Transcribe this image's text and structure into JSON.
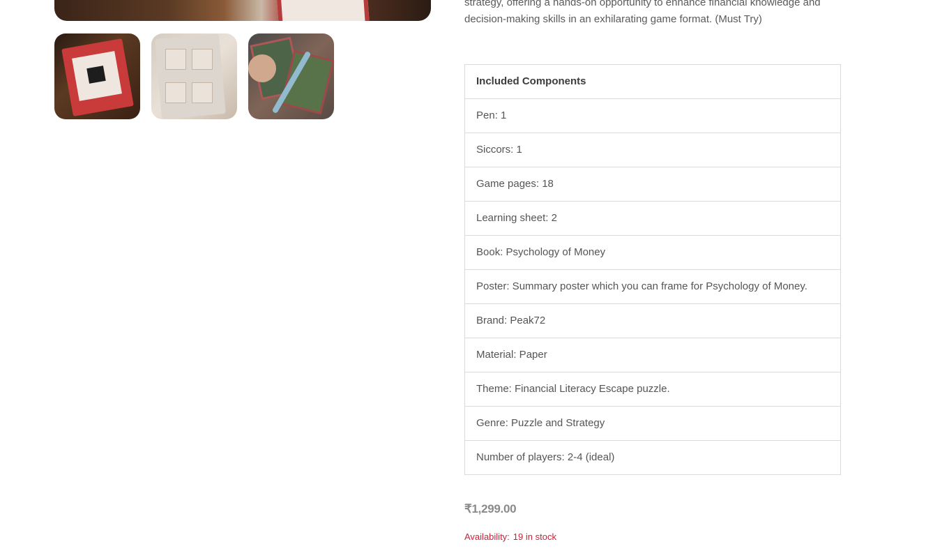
{
  "description": "strategy, offering a hands-on opportunity to enhance financial knowledge and decision-making skills in an exhilarating game format. (Must Try)",
  "components": {
    "header": "Included Components",
    "rows": [
      "Pen: 1",
      "Siccors: 1",
      "Game pages: 18",
      "Learning sheet: 2",
      "Book: Psychology of Money",
      "Poster: Summary poster which you can frame for Psychology of Money.",
      "Brand: Peak72",
      "Material: Paper",
      "Theme: Financial Literacy Escape puzzle.",
      "Genre: Puzzle and Strategy",
      "Number of players: 2-4 (ideal)"
    ]
  },
  "price": "₹1,299.00",
  "availability": {
    "label": "Availability:",
    "value": "19 in stock"
  },
  "colors": {
    "availability": "#c8233b",
    "border": "#dadada"
  }
}
